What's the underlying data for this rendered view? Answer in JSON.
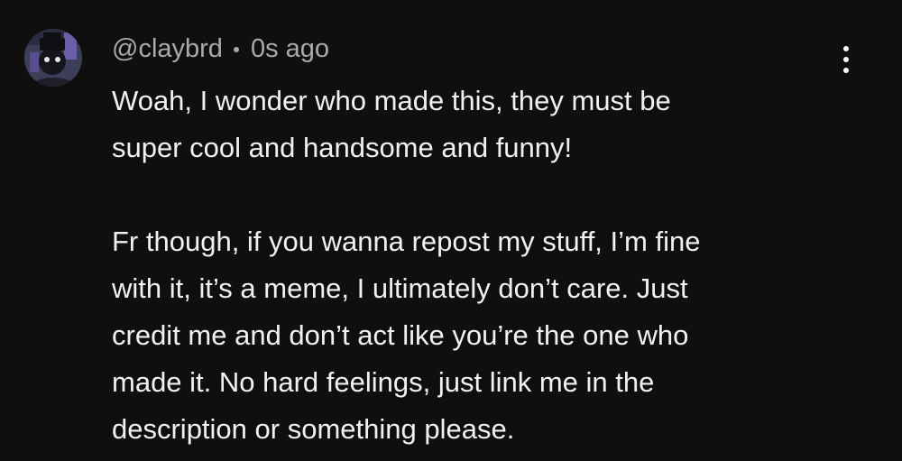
{
  "comment": {
    "author": "@claybrd",
    "timestamp": "0s ago",
    "menu_icon": "more-vertical-icon",
    "avatar_icon": "avatar-icon",
    "paragraphs": [
      [
        "Woah, I wonder who made this, they must be",
        "super cool and handsome and funny!"
      ],
      [
        "Fr though, if you wanna repost my stuff, I’m fine",
        "with it, it’s a meme, I ultimately don’t care. Just",
        "credit me and don’t act like you’re the one who",
        "made it. No hard feelings, just link me in the",
        "description or something please."
      ]
    ]
  },
  "colors": {
    "background": "#0f0f0f",
    "text": "#f1f1f1",
    "meta": "#aaaaaa"
  }
}
